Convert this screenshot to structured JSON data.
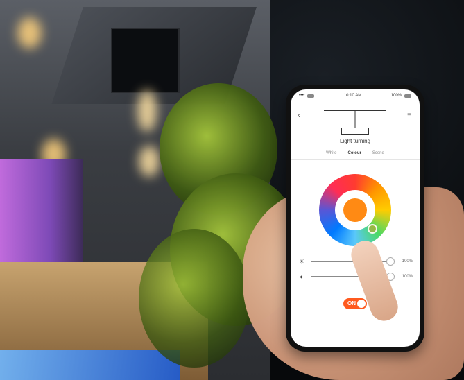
{
  "phone": {
    "status": {
      "left": "•••• ",
      "center": "10:10 AM",
      "right": "100%"
    },
    "header": {
      "back_label": "‹",
      "menu_label": "≡"
    },
    "device_title": "Light turning",
    "tabs": [
      {
        "label": "White"
      },
      {
        "label": "Colour",
        "active": true
      },
      {
        "label": "Scene"
      }
    ],
    "sliders": [
      {
        "icon": "sun-icon",
        "glyph": "☀",
        "value": "100%"
      },
      {
        "icon": "contrast-icon",
        "glyph": "◐",
        "value": "100%"
      }
    ],
    "toggle": {
      "label": "ON"
    },
    "accent_color": "#ff5a1f",
    "selected_color": "#ff8a14"
  }
}
